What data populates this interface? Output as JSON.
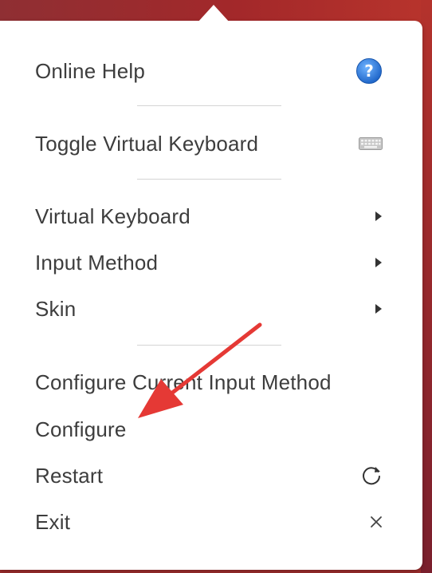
{
  "menu": {
    "items": [
      {
        "label": "Online Help",
        "icon": "help-icon"
      },
      {
        "label": "Toggle Virtual Keyboard",
        "icon": "keyboard-icon"
      },
      {
        "label": "Virtual Keyboard",
        "icon": "submenu-arrow-icon"
      },
      {
        "label": "Input Method",
        "icon": "submenu-arrow-icon"
      },
      {
        "label": "Skin",
        "icon": "submenu-arrow-icon"
      },
      {
        "label": "Configure Current Input Method",
        "icon": ""
      },
      {
        "label": "Configure",
        "icon": ""
      },
      {
        "label": "Restart",
        "icon": "restart-icon"
      },
      {
        "label": "Exit",
        "icon": "close-icon"
      }
    ]
  },
  "annotation": {
    "type": "red-arrow",
    "points_to": "Configure",
    "color": "#e53935"
  },
  "colors": {
    "help_icon": "#2f80ed",
    "menu_text": "#3d3d3d",
    "separator": "#d4d4d4"
  }
}
